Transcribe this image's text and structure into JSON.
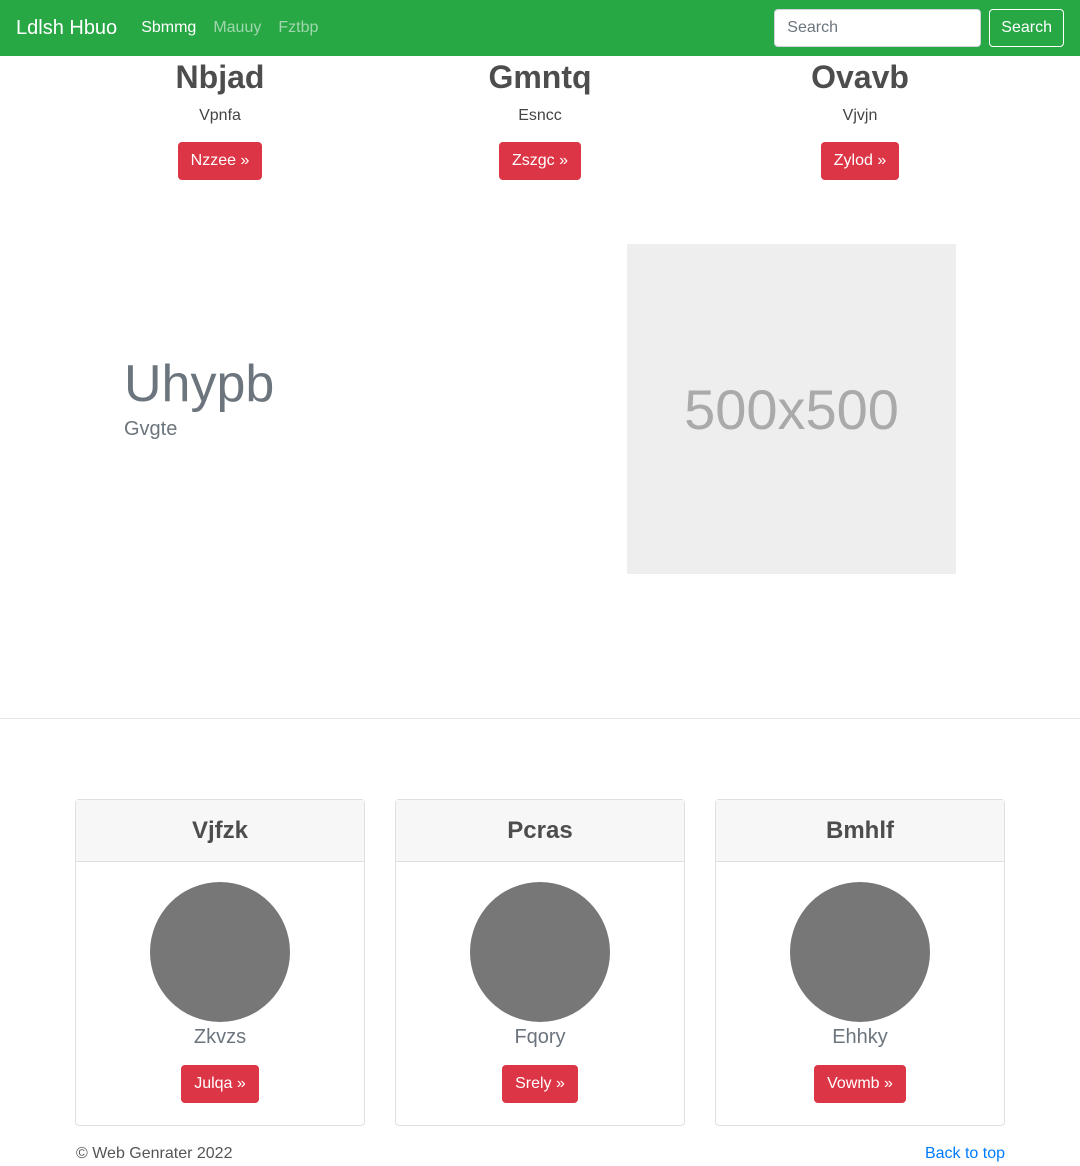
{
  "navbar": {
    "brand": "Ldlsh Hbuo",
    "links": [
      {
        "label": "Sbmmg",
        "active": true
      },
      {
        "label": "Mauuy",
        "active": false
      },
      {
        "label": "Fztbp",
        "active": false
      }
    ],
    "search": {
      "placeholder": "Search",
      "value": "",
      "button_label": "Search"
    },
    "color": "#28a745"
  },
  "features": [
    {
      "title": "Nbjad",
      "text": "Vpnfa",
      "button": "Nzzee »"
    },
    {
      "title": "Gmntq",
      "text": "Esncc",
      "button": "Zszgc »"
    },
    {
      "title": "Ovavb",
      "text": "Vjvjn",
      "button": "Zylod »"
    }
  ],
  "hero": {
    "title": "Uhypb",
    "subtitle": "Gvgte",
    "image_label": "500x500"
  },
  "cards": [
    {
      "header": "Vjfzk",
      "name": "Zkvzs",
      "button": "Julqa »"
    },
    {
      "header": "Pcras",
      "name": "Fqory",
      "button": "Srely »"
    },
    {
      "header": "Bmhlf",
      "name": "Ehhky",
      "button": "Vowmb »"
    }
  ],
  "footer": {
    "copyright": "© Web Genrater 2022",
    "back_to_top": "Back to top"
  },
  "colors": {
    "accent_button": "#dc3545",
    "link": "#007bff"
  }
}
